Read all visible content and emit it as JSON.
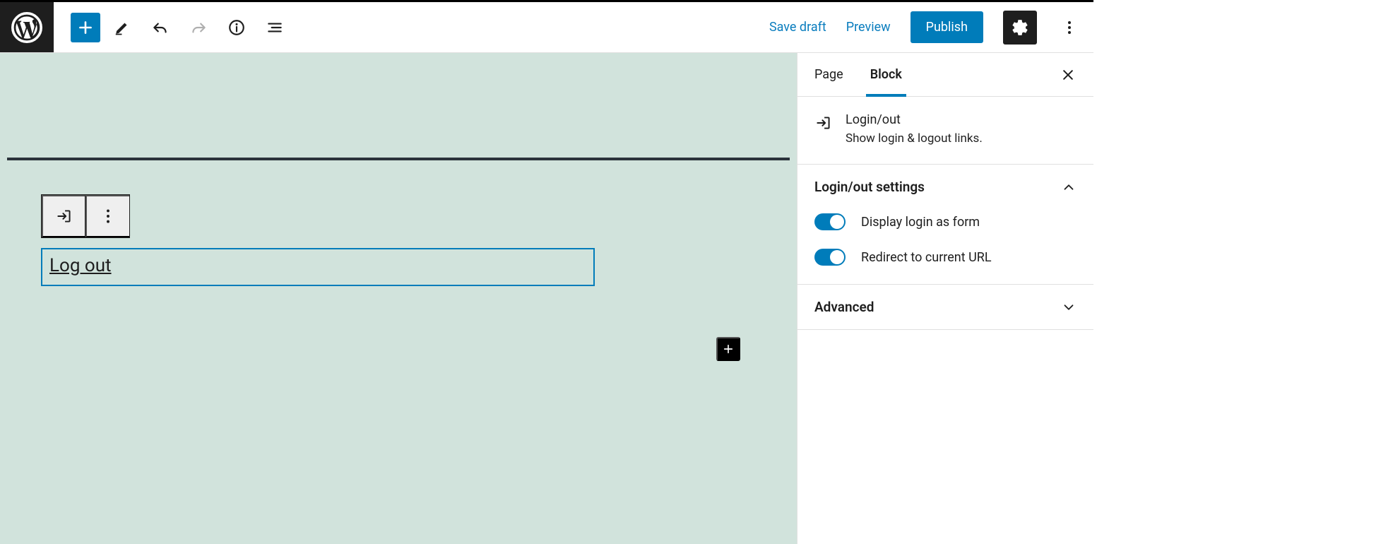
{
  "topbar": {
    "save_draft": "Save draft",
    "preview": "Preview",
    "publish": "Publish"
  },
  "canvas": {
    "block_link_text": "Log out"
  },
  "sidebar": {
    "tabs": {
      "page": "Page",
      "block": "Block"
    },
    "block_card": {
      "title": "Login/out",
      "description": "Show login & logout links."
    },
    "panel_settings": {
      "title": "Login/out settings",
      "toggle_form": "Display login as form",
      "toggle_redirect": "Redirect to current URL"
    },
    "panel_advanced": {
      "title": "Advanced"
    }
  }
}
